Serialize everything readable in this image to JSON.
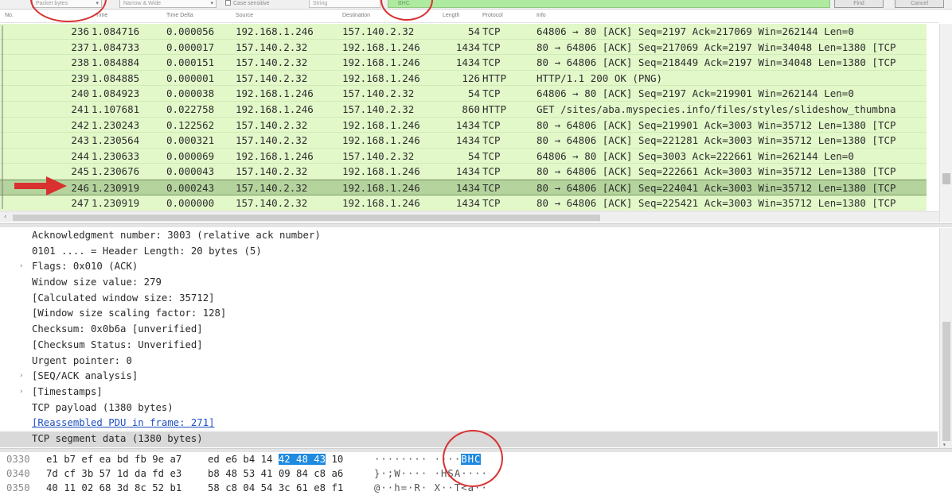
{
  "findbar": {
    "display_select": "Packet bytes",
    "charset_select": "Narrow & Wide",
    "case_sensitive_label": "Case sensitive",
    "search_type": "String",
    "filter_text": "BHC",
    "find_button": "Find",
    "cancel_button": "Cancel"
  },
  "packet_list": {
    "columns": [
      "No.",
      "Time",
      "Time Delta",
      "Source",
      "Destination",
      "Length",
      "Protocol",
      "Info"
    ],
    "rows": [
      {
        "no": "236",
        "time": "1.084716",
        "delta": "0.000056",
        "src": "192.168.1.246",
        "dst": "157.140.2.32",
        "len": "54",
        "proto": "TCP",
        "info": "64806 → 80 [ACK] Seq=2197 Ack=217069 Win=262144 Len=0"
      },
      {
        "no": "237",
        "time": "1.084733",
        "delta": "0.000017",
        "src": "157.140.2.32",
        "dst": "192.168.1.246",
        "len": "1434",
        "proto": "TCP",
        "info": "80 → 64806 [ACK] Seq=217069 Ack=2197 Win=34048 Len=1380 [TCP"
      },
      {
        "no": "238",
        "time": "1.084884",
        "delta": "0.000151",
        "src": "157.140.2.32",
        "dst": "192.168.1.246",
        "len": "1434",
        "proto": "TCP",
        "info": "80 → 64806 [ACK] Seq=218449 Ack=2197 Win=34048 Len=1380 [TCP"
      },
      {
        "no": "239",
        "time": "1.084885",
        "delta": "0.000001",
        "src": "157.140.2.32",
        "dst": "192.168.1.246",
        "len": "126",
        "proto": "HTTP",
        "info": "HTTP/1.1 200 OK  (PNG)"
      },
      {
        "no": "240",
        "time": "1.084923",
        "delta": "0.000038",
        "src": "192.168.1.246",
        "dst": "157.140.2.32",
        "len": "54",
        "proto": "TCP",
        "info": "64806 → 80 [ACK] Seq=2197 Ack=219901 Win=262144 Len=0"
      },
      {
        "no": "241",
        "time": "1.107681",
        "delta": "0.022758",
        "src": "192.168.1.246",
        "dst": "157.140.2.32",
        "len": "860",
        "proto": "HTTP",
        "info": "GET /sites/aba.myspecies.info/files/styles/slideshow_thumbna"
      },
      {
        "no": "242",
        "time": "1.230243",
        "delta": "0.122562",
        "src": "157.140.2.32",
        "dst": "192.168.1.246",
        "len": "1434",
        "proto": "TCP",
        "info": "80 → 64806 [ACK] Seq=219901 Ack=3003 Win=35712 Len=1380 [TCP"
      },
      {
        "no": "243",
        "time": "1.230564",
        "delta": "0.000321",
        "src": "157.140.2.32",
        "dst": "192.168.1.246",
        "len": "1434",
        "proto": "TCP",
        "info": "80 → 64806 [ACK] Seq=221281 Ack=3003 Win=35712 Len=1380 [TCP"
      },
      {
        "no": "244",
        "time": "1.230633",
        "delta": "0.000069",
        "src": "192.168.1.246",
        "dst": "157.140.2.32",
        "len": "54",
        "proto": "TCP",
        "info": "64806 → 80 [ACK] Seq=3003 Ack=222661 Win=262144 Len=0"
      },
      {
        "no": "245",
        "time": "1.230676",
        "delta": "0.000043",
        "src": "157.140.2.32",
        "dst": "192.168.1.246",
        "len": "1434",
        "proto": "TCP",
        "info": "80 → 64806 [ACK] Seq=222661 Ack=3003 Win=35712 Len=1380 [TCP"
      },
      {
        "no": "246",
        "time": "1.230919",
        "delta": "0.000243",
        "src": "157.140.2.32",
        "dst": "192.168.1.246",
        "len": "1434",
        "proto": "TCP",
        "info": "80 → 64806 [ACK] Seq=224041 Ack=3003 Win=35712 Len=1380 [TCP"
      },
      {
        "no": "247",
        "time": "1.230919",
        "delta": "0.000000",
        "src": "157.140.2.32",
        "dst": "192.168.1.246",
        "len": "1434",
        "proto": "TCP",
        "info": "80 → 64806 [ACK] Seq=225421 Ack=3003 Win=35712 Len=1380 [TCP"
      }
    ],
    "selected_no": "246"
  },
  "details": [
    {
      "text": "Acknowledgment number: 3003    (relative ack number)"
    },
    {
      "text": "0101 .... = Header Length: 20 bytes (5)"
    },
    {
      "text": "Flags: 0x010 (ACK)",
      "expander": "›"
    },
    {
      "text": "Window size value: 279"
    },
    {
      "text": "[Calculated window size: 35712]"
    },
    {
      "text": "[Window size scaling factor: 128]"
    },
    {
      "text": "Checksum: 0x0b6a [unverified]"
    },
    {
      "text": "[Checksum Status: Unverified]"
    },
    {
      "text": "Urgent pointer: 0"
    },
    {
      "text": "[SEQ/ACK analysis]",
      "expander": "›"
    },
    {
      "text": "[Timestamps]",
      "expander": "›"
    },
    {
      "text": "TCP payload (1380 bytes)"
    },
    {
      "text": "[Reassembled PDU in frame: 271]"
    },
    {
      "text": "TCP segment data (1380 bytes)"
    }
  ],
  "bytes": [
    {
      "offset": "0330",
      "hex1": "e1 b7 ef ea bd fb 9e a7",
      "hex2_pre": "ed e6 b4 14 ",
      "hex2_hl": "42 48 43",
      "hex2_post": " 10",
      "ascii_pre": "········ ····",
      "ascii_hl": "BHC",
      "ascii_post": ""
    },
    {
      "offset": "0340",
      "hex1": "7d cf 3b 57 1d da fd e3",
      "hex2_pre": "b8 48 53 41 09 84 c8 a6",
      "hex2_hl": "",
      "hex2_post": "",
      "ascii_pre": "}·;W···· ·HSA····",
      "ascii_hl": "",
      "ascii_post": ""
    },
    {
      "offset": "0350",
      "hex1": "40 11 02 68 3d 8c 52 b1",
      "hex2_pre": "58 c8 04 54 3c 61 e8 f1",
      "hex2_hl": "",
      "hex2_post": "",
      "ascii_pre": "@··h=·R· X··T<a··",
      "ascii_hl": "",
      "ascii_post": ""
    }
  ],
  "colors": {
    "tcp_row": "#e2f8c9",
    "selected_row": "#b5d49d",
    "filter_bg": "#aeeaa0",
    "annotation_red": "#d93030",
    "byte_highlight": "#1e8ae0"
  }
}
